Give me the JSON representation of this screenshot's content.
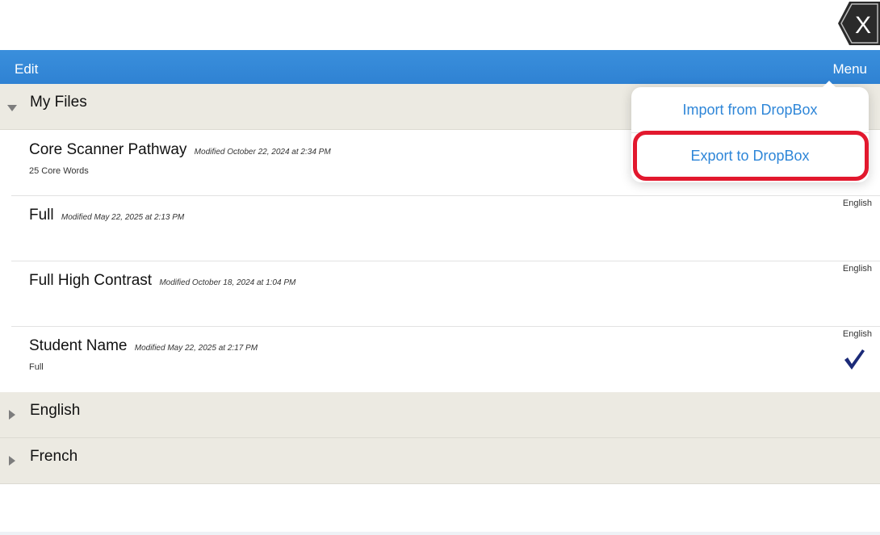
{
  "navbar": {
    "edit_label": "Edit",
    "menu_label": "Menu",
    "color": "#2f86d6"
  },
  "close_button": {
    "icon": "close-x-icon"
  },
  "sections": [
    {
      "title": "My Files",
      "expanded": true
    },
    {
      "title": "English",
      "expanded": false
    },
    {
      "title": "French",
      "expanded": false
    }
  ],
  "files": [
    {
      "name": "Core Scanner Pathway",
      "modified": "Modified October 22, 2024 at 2:34 PM",
      "subtitle": "25 Core Words",
      "language": "",
      "selected": false
    },
    {
      "name": "Full",
      "modified": "Modified May 22, 2025 at 2:13 PM",
      "subtitle": "",
      "language": "English",
      "selected": false
    },
    {
      "name": "Full High Contrast",
      "modified": "Modified October 18, 2024 at 1:04 PM",
      "subtitle": "",
      "language": "English",
      "selected": false
    },
    {
      "name": "Student Name",
      "modified": "Modified May 22, 2025 at 2:17 PM",
      "subtitle": "Full",
      "language": "English",
      "selected": true
    }
  ],
  "menu_popover": {
    "items": [
      "Import from DropBox",
      "Export to DropBox"
    ],
    "highlighted_item": "Export to DropBox",
    "highlight_color": "#e2182e"
  }
}
